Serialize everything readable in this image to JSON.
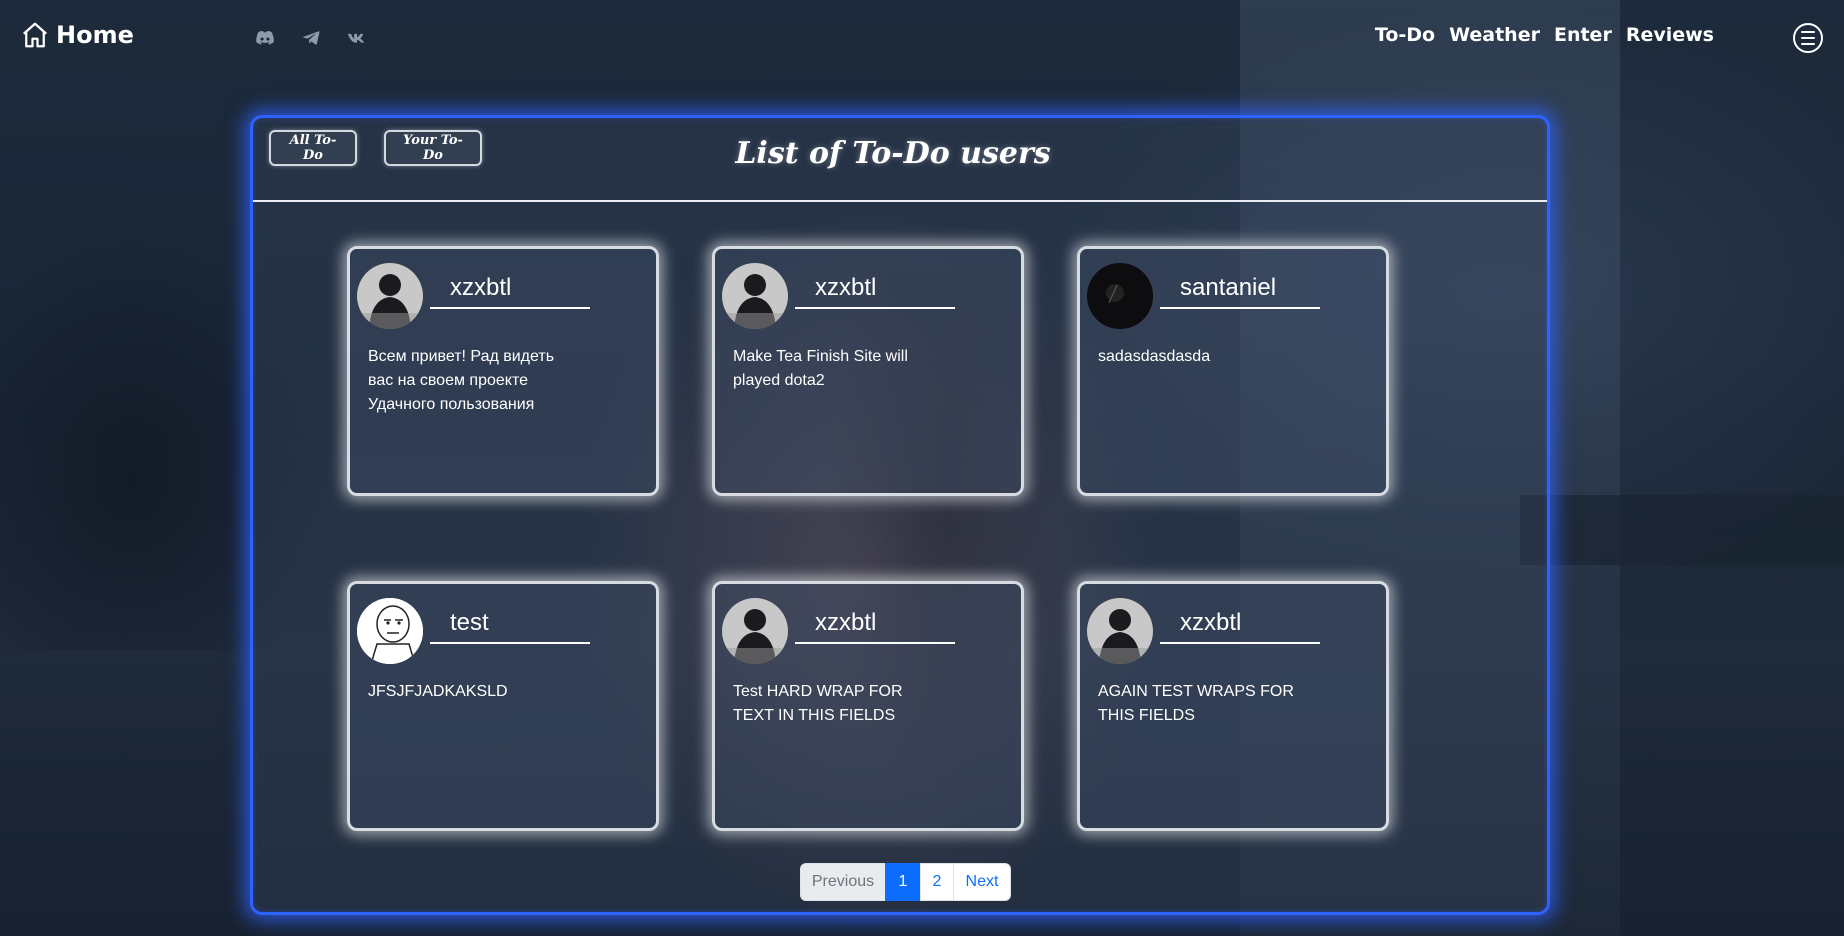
{
  "nav": {
    "brand": "Home",
    "socials": [
      "discord-icon",
      "telegram-icon",
      "vk-icon"
    ],
    "links": [
      "To-Do",
      "Weather",
      "Enter",
      "Reviews"
    ]
  },
  "panel": {
    "filter_all": "All To-Do",
    "filter_yours": "Your To-Do",
    "title": "List of To-Do users"
  },
  "cards": [
    {
      "name": "xzxbtl",
      "text": "Всем привет! Рад видеть вас на своем проекте Удачного пользования",
      "avatar": "dark-user-avatar"
    },
    {
      "name": "xzxbtl",
      "text": "Make Tea Finish Site will played dota2",
      "avatar": "dark-user-avatar"
    },
    {
      "name": "santaniel",
      "text": "sadasdasdasda",
      "avatar": "black-avatar"
    },
    {
      "name": "test",
      "text": "JFSJFJADKAKSLD",
      "avatar": "meme-face-avatar"
    },
    {
      "name": "xzxbtl",
      "text": "Test HARD WRAP FOR TEXT IN THIS FIELDS",
      "avatar": "dark-user-avatar"
    },
    {
      "name": "xzxbtl",
      "text": "AGAIN TEST WRAPS FOR THIS FIELDS",
      "avatar": "dark-user-avatar"
    }
  ],
  "pagination": {
    "previous": "Previous",
    "pages": [
      "1",
      "2"
    ],
    "active_page": "1",
    "next": "Next"
  },
  "colors": {
    "panel_glow": "#2f63ff",
    "page_active": "#0d6efd"
  }
}
